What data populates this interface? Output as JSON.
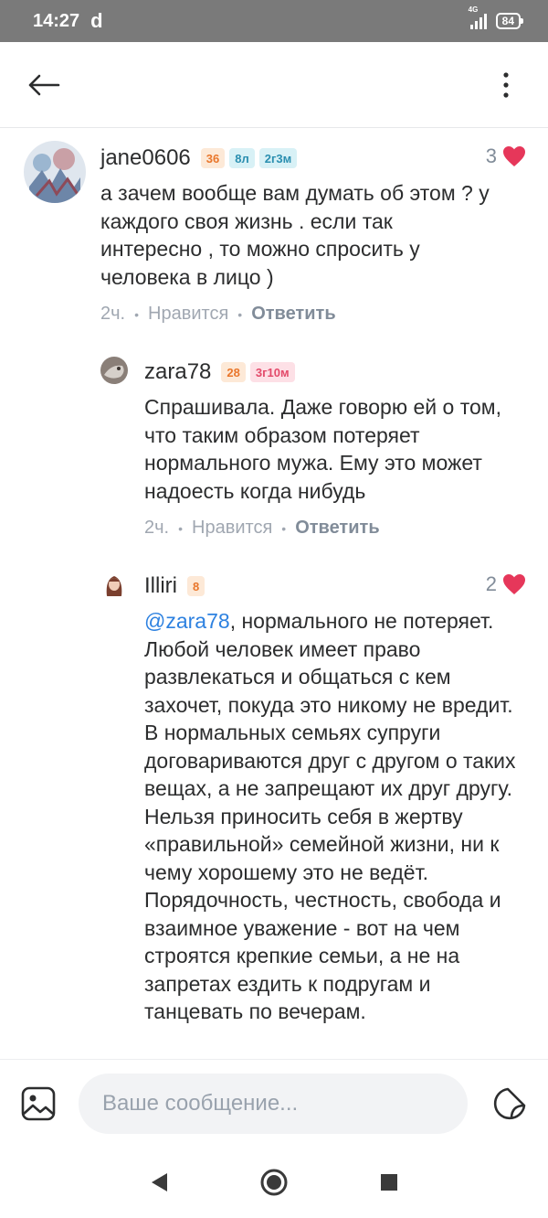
{
  "status_bar": {
    "time": "14:27",
    "extra_icon": "d",
    "network": "4G",
    "battery": "84"
  },
  "header": {
    "back_icon": "arrow-left-icon",
    "menu_icon": "more-vertical-icon"
  },
  "comments": [
    {
      "author": "jane0606",
      "badges": [
        "36",
        "8л",
        "2г3м"
      ],
      "likes": "3",
      "text": "а зачем вообще вам думать об этом ? у каждого своя жизнь . если так интересно , то можно спросить у человека в лицо )",
      "time": "2ч.",
      "like_action": "Нравится",
      "reply_action": "Ответить"
    },
    {
      "author": "zara78",
      "badges": [
        "28",
        "3г10м"
      ],
      "text": "Спрашивала. Даже говорю ей о том, что таким образом потеряет нормального мужа. Ему это может надоесть когда нибудь",
      "time": "2ч.",
      "like_action": "Нравится",
      "reply_action": "Ответить"
    },
    {
      "author": "Illiri",
      "badges": [
        "8"
      ],
      "likes": "2",
      "mention": "@zara78",
      "text": ", нормального не потеряет. Любой человек имеет право развлекаться и общаться с кем захочет, покуда это никому не вредит. В нормальных семьях супруги договариваются друг с другом о таких вещах, а не запрещают их друг другу. Нельзя приносить себя в жертву «правильной» семейной жизни, ни к чему хорошему это не ведёт. Порядочность, честность, свобода и взаимное уважение - вот на чем строятся крепкие семьи, а не на запретах ездить к подругам и танцевать по вечерам."
    }
  ],
  "input": {
    "placeholder": "Ваше сообщение..."
  },
  "colors": {
    "heart": "#e6375a",
    "mention": "#2d81e0",
    "badge_orange": "#e9762b",
    "badge_cyan": "#2b8fb0",
    "badge_pink": "#e34a6a"
  }
}
